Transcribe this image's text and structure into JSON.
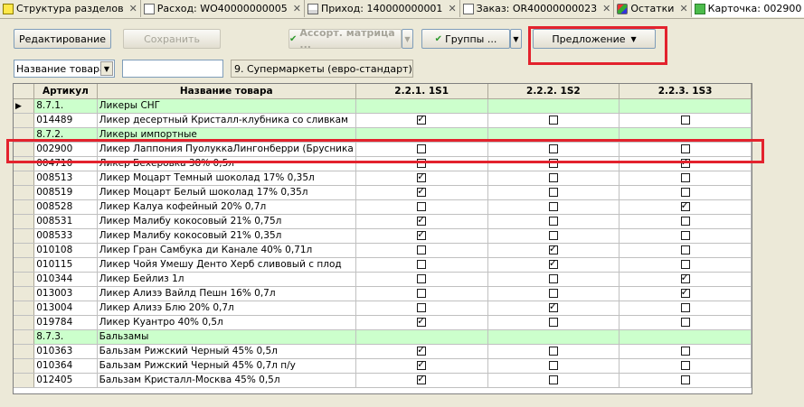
{
  "tabs": [
    {
      "label": "Структура разделов",
      "icon": "yel"
    },
    {
      "label": "Расход: WO40000000005",
      "icon": "doc"
    },
    {
      "label": "Приход: 140000000001",
      "icon": "doc2"
    },
    {
      "label": "Заказ: OR40000000023",
      "icon": "doc"
    },
    {
      "label": "Остатки",
      "icon": "mul"
    },
    {
      "label": "Карточка: 002900",
      "icon": "grn"
    }
  ],
  "tab_close": "✕",
  "toolbar": {
    "edit": "Редактирование",
    "save": "Сохранить",
    "assort": "Ассорт. матрица ...",
    "groups": "Группы ...",
    "offer": "Предложение"
  },
  "filter": {
    "field": "Название товара",
    "value": "",
    "segment": "9. Супермаркеты (евро-стандарт)"
  },
  "columns": [
    "Артикул",
    "Название товара",
    "2.2.1. 1S1",
    "2.2.2. 1S2",
    "2.2.3. 1S3"
  ],
  "rows": [
    {
      "type": "group",
      "code": "8.7.1.",
      "name": "Ликеры СНГ",
      "current": true
    },
    {
      "code": "014489",
      "name": "Ликер десертный Кристалл-клубника со сливкам",
      "s": [
        1,
        0,
        0
      ]
    },
    {
      "type": "group",
      "code": "8.7.2.",
      "name": "Ликеры импортные"
    },
    {
      "code": "002900",
      "name": "Ликер Лаппония ПуолуккаЛингонберри (Брусника",
      "s": [
        0,
        0,
        0
      ]
    },
    {
      "code": "004710",
      "name": "Ликер Бехеровка 38% 0,5л",
      "s": [
        0,
        0,
        1
      ]
    },
    {
      "code": "008513",
      "name": "Ликер Моцарт Темный шоколад 17% 0,35л",
      "s": [
        1,
        0,
        0
      ]
    },
    {
      "code": "008519",
      "name": "Ликер Моцарт Белый шоколад 17% 0,35л",
      "s": [
        1,
        0,
        0
      ]
    },
    {
      "code": "008528",
      "name": "Ликер Калуа кофейный 20% 0,7л",
      "s": [
        0,
        0,
        1
      ]
    },
    {
      "code": "008531",
      "name": "Ликер Малибу кокосовый 21% 0,75л",
      "s": [
        1,
        0,
        0
      ]
    },
    {
      "code": "008533",
      "name": "Ликер Малибу кокосовый 21% 0,35л",
      "s": [
        1,
        0,
        0
      ]
    },
    {
      "code": "010108",
      "name": "Ликер Гран Самбука ди Канале 40% 0,71л",
      "s": [
        0,
        1,
        0
      ]
    },
    {
      "code": "010115",
      "name": "Ликер Чойя Умешу Денто Херб сливовый с плод",
      "s": [
        0,
        1,
        0
      ]
    },
    {
      "code": "010344",
      "name": "Ликер Бейлиз 1л",
      "s": [
        0,
        0,
        1
      ]
    },
    {
      "code": "013003",
      "name": "Ликер Ализэ Вайлд Пешн 16% 0,7л",
      "s": [
        0,
        0,
        1
      ]
    },
    {
      "code": "013004",
      "name": "Ликер Ализэ Блю 20% 0,7л",
      "s": [
        0,
        1,
        0
      ]
    },
    {
      "code": "019784",
      "name": "Ликер Куантро 40% 0,5л",
      "s": [
        1,
        0,
        0
      ]
    },
    {
      "type": "group",
      "code": "8.7.3.",
      "name": "Бальзамы"
    },
    {
      "code": "010363",
      "name": "Бальзам Рижский Черный 45% 0,5л",
      "s": [
        1,
        0,
        0
      ]
    },
    {
      "code": "010364",
      "name": "Бальзам Рижский Черный 45% 0,7л п/у",
      "s": [
        1,
        0,
        0
      ]
    },
    {
      "code": "012405",
      "name": "Бальзам Кристалл-Москва 45% 0,5л",
      "s": [
        1,
        0,
        0
      ]
    }
  ],
  "colors": {
    "group_row": "#ccffcc",
    "highlight": "#e3222d"
  }
}
